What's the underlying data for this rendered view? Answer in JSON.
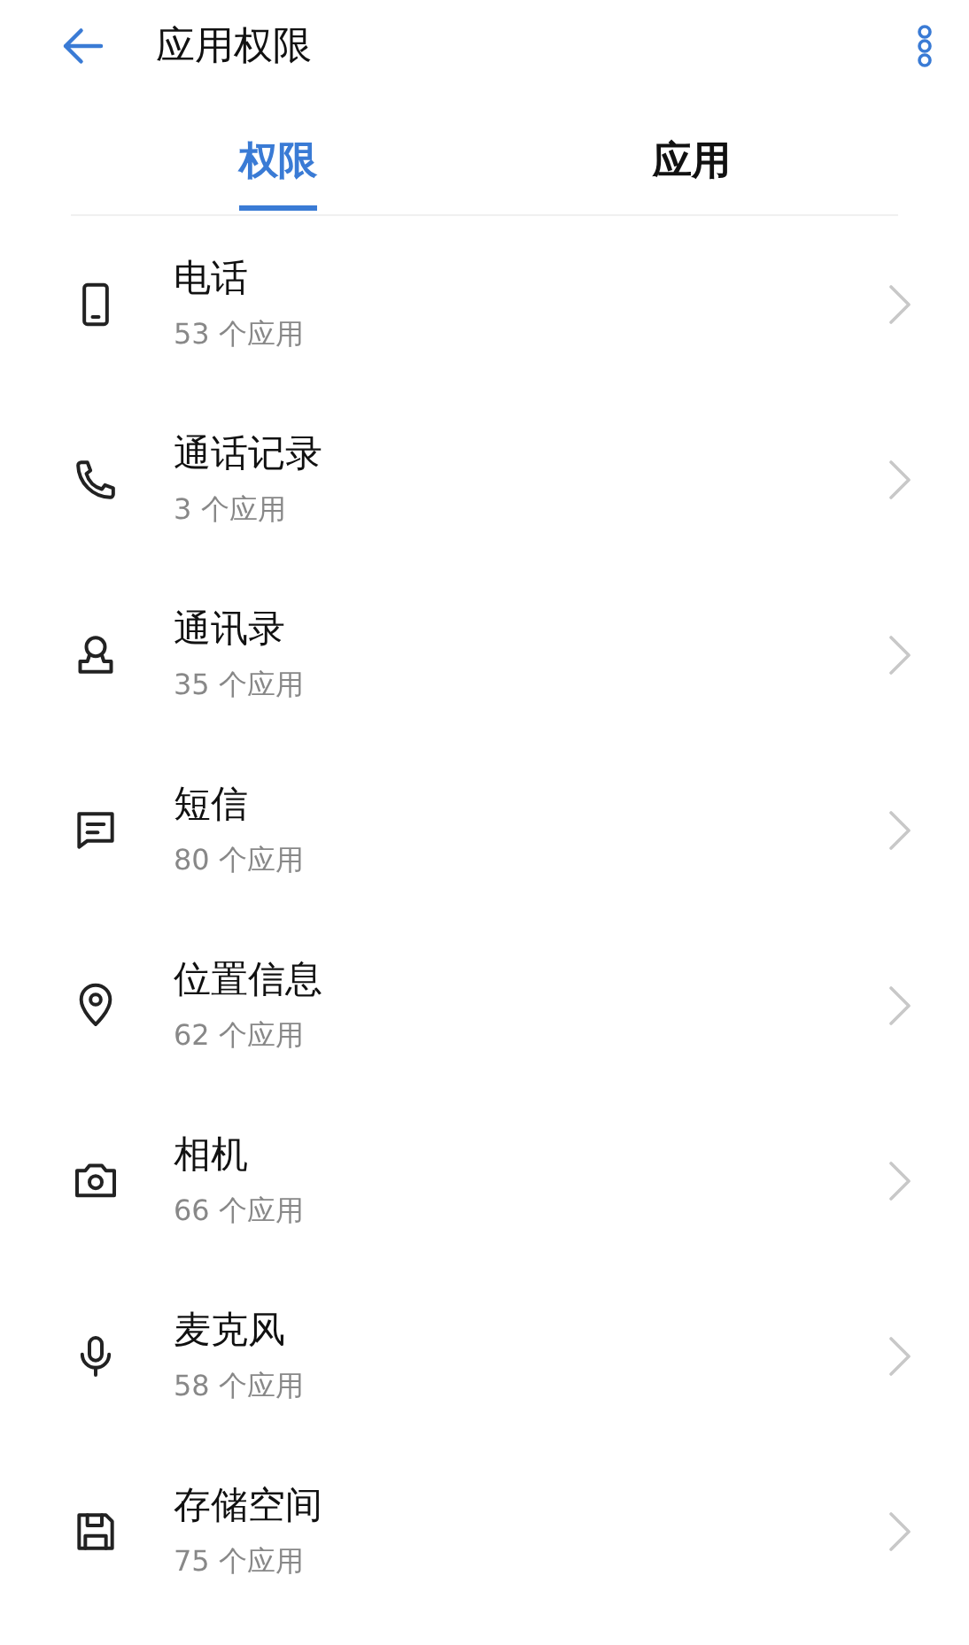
{
  "header": {
    "title": "应用权限"
  },
  "tabs": [
    {
      "label": "权限",
      "selected": true
    },
    {
      "label": "应用",
      "selected": false
    }
  ],
  "permissions": [
    {
      "name": "电话",
      "count": "53 个应用"
    },
    {
      "name": "通话记录",
      "count": "3 个应用"
    },
    {
      "name": "通讯录",
      "count": "35 个应用"
    },
    {
      "name": "短信",
      "count": "80 个应用"
    },
    {
      "name": "位置信息",
      "count": "62 个应用"
    },
    {
      "name": "相机",
      "count": "66 个应用"
    },
    {
      "name": "麦克风",
      "count": "58 个应用"
    },
    {
      "name": "存储空间",
      "count": "75 个应用"
    }
  ]
}
